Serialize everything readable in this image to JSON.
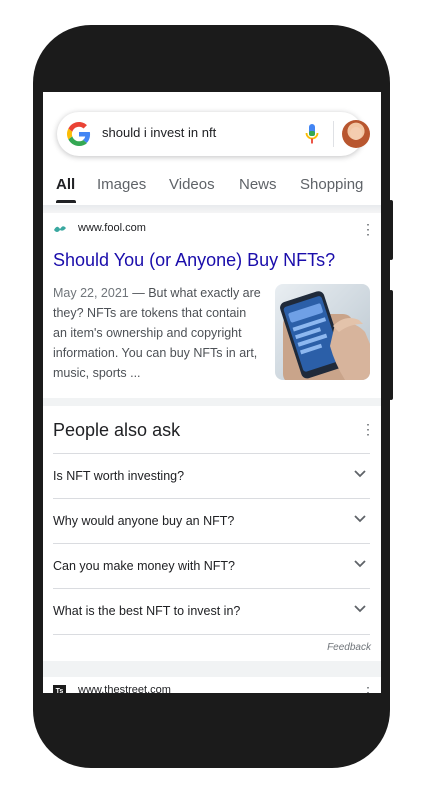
{
  "search": {
    "query": "should i invest in nft"
  },
  "tabs": [
    {
      "label": "All",
      "active": true
    },
    {
      "label": "Images"
    },
    {
      "label": "Videos"
    },
    {
      "label": "News"
    },
    {
      "label": "Shopping"
    }
  ],
  "result1": {
    "site": "www.fool.com",
    "title": "Should You (or Anyone) Buy NFTs?",
    "date": "May 22, 2021",
    "snippet": " — But what exactly are they? NFTs are tokens that contain an item's ownership and copyright information. You can buy NFTs in art, music, sports ..."
  },
  "people_also_ask": {
    "title": "People also ask",
    "questions": [
      "Is NFT worth investing?",
      "Why would anyone buy an NFT?",
      "Can you make money with NFT?",
      "What is the best NFT to invest in?"
    ],
    "feedback": "Feedback"
  },
  "result2": {
    "site": "www.thestreet.com",
    "logo_text": "Ts"
  },
  "icons": {
    "google": "google-g-icon",
    "mic": "mic-icon",
    "more": "more-vert-icon",
    "expand": "chevron-down-icon"
  },
  "colors": {
    "link": "#1a0dab",
    "phone": "#1b1b1b",
    "google_blue": "#4285f4",
    "google_red": "#ea4335",
    "google_yellow": "#fbbc05",
    "google_green": "#34a853"
  }
}
